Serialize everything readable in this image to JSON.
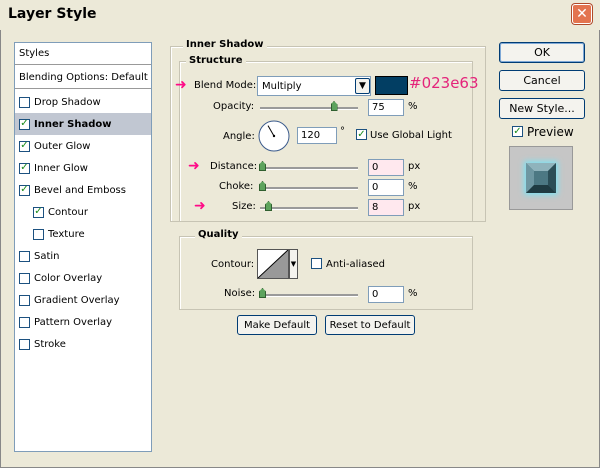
{
  "window": {
    "title": "Layer Style"
  },
  "sidebar": {
    "header": "Styles",
    "blending": "Blending Options: Default",
    "items": [
      {
        "label": "Drop Shadow",
        "checked": false
      },
      {
        "label": "Inner Shadow",
        "checked": true,
        "active": true
      },
      {
        "label": "Outer Glow",
        "checked": true
      },
      {
        "label": "Inner Glow",
        "checked": true
      },
      {
        "label": "Bevel and Emboss",
        "checked": true
      },
      {
        "label": "Contour",
        "checked": true,
        "indent": true
      },
      {
        "label": "Texture",
        "checked": false,
        "indent": true
      },
      {
        "label": "Satin",
        "checked": false
      },
      {
        "label": "Color Overlay",
        "checked": false
      },
      {
        "label": "Gradient Overlay",
        "checked": false
      },
      {
        "label": "Pattern Overlay",
        "checked": false
      },
      {
        "label": "Stroke",
        "checked": false
      }
    ]
  },
  "inner_shadow": {
    "section_title": "Inner Shadow",
    "structure": {
      "title": "Structure",
      "blend_mode_label": "Blend Mode:",
      "blend_mode_value": "Multiply",
      "swatch_color": "#023e63",
      "swatch_hex_text": "#023e63",
      "opacity_label": "Opacity:",
      "opacity_value": "75",
      "opacity_percent": 75,
      "percent_unit": "%",
      "angle_label": "Angle:",
      "angle_value": "120",
      "degree_symbol": "°",
      "use_global_light_label": "Use Global Light",
      "use_global_light_checked": true,
      "distance_label": "Distance:",
      "distance_value": "0",
      "px_unit": "px",
      "choke_label": "Choke:",
      "choke_value": "0",
      "size_label": "Size:",
      "size_value": "8"
    },
    "quality": {
      "title": "Quality",
      "contour_label": "Contour:",
      "anti_aliased_label": "Anti-aliased",
      "anti_aliased_checked": false,
      "noise_label": "Noise:",
      "noise_value": "0"
    }
  },
  "footer_buttons": {
    "make_default": "Make Default",
    "reset_default": "Reset to Default"
  },
  "right_panel": {
    "ok": "OK",
    "cancel": "Cancel",
    "new_style": "New Style...",
    "preview_label": "Preview",
    "preview_checked": true,
    "preview_color": "#3F6F7B"
  },
  "colors": {
    "annotation_pink": "#FF0A87",
    "highlight_hex_text": "#E4237A"
  }
}
